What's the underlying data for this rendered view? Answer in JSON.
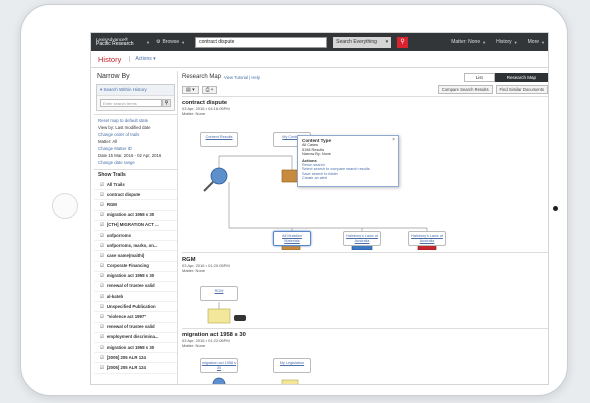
{
  "topbar": {
    "brand_line1": "LexisAdvance®",
    "brand_line2": "Pacific Research",
    "browse": "Browse",
    "search_value": "contract dispute",
    "search_scope": "Search Everything",
    "matter": "Matter: None",
    "history": "History",
    "more": "More"
  },
  "header": {
    "title": "History",
    "actions": "Actions"
  },
  "left": {
    "title": "Narrow By",
    "search_within": "Search Within History",
    "search_placeholder": "Enter search terms",
    "reset_link": "Reset map to default state",
    "view_by_label": "View by: Last modified date",
    "change_order": "Change order of trails",
    "matter_label": "Matter: All",
    "change_matter": "Change Matter ID",
    "date_label": "Date 15 Mar, 2016 - 02 Apr, 2016",
    "change_date": "Change date range",
    "show_trails": "Show Trails",
    "trails": [
      "All Trails",
      "contract dispute",
      "RGM",
      "migration act 1958 s 30",
      "[CTH] MIGRATION ACT ...",
      "unfporroms",
      "unfporroms, marko, on...",
      "case name(maithi)",
      "Corporate Financing",
      "migration act 1958 s 30",
      "renewal of trustee valid",
      "al-kateb",
      "Unspecified Publication",
      "\"violence act 1997\"",
      "renewal of trustee valid",
      "employment discrimina...",
      "migration act 1958 s 30",
      "[2005] 205 ALR 124",
      "[2005] 205 ALR 124"
    ]
  },
  "main": {
    "title": "Research Map",
    "links": "View Tutorial | Help",
    "list_btn": "List",
    "map_btn": "Research Map",
    "compare_btn": "Compare Search Results",
    "similar_btn": "Find Similar Documents",
    "maps": [
      {
        "title": "contract dispute",
        "date": "03 Apr, 2016 • 04:16:05PM",
        "matter": "Matter: None",
        "node1": "Content Results",
        "node2": "My Content",
        "node3": "All Mutation Materials",
        "node4": "Halsbury's Laws of Australia",
        "node5": "Halsbury's Laws of Australia"
      },
      {
        "title": "RGM",
        "date": "03 Apr, 2016 • 01:20:05PM",
        "matter": "Matter: None",
        "node1": "RGM"
      },
      {
        "title": "migration act 1958 s 30",
        "date": "03 Apr, 2016 • 01:22:06PM",
        "matter": "Matter: None",
        "node1": "migration act 1958 s 30",
        "node2": "My Legislation"
      }
    ],
    "popup": {
      "title": "Content Type",
      "l1": "All Cases",
      "l2": "5158 Results",
      "l3": "Narrow By: None",
      "actions": "Actions",
      "a1": "Rerun search",
      "a2": "Select search to compare search results",
      "a3": "Save search to folder",
      "a4": "Create an alert"
    }
  }
}
